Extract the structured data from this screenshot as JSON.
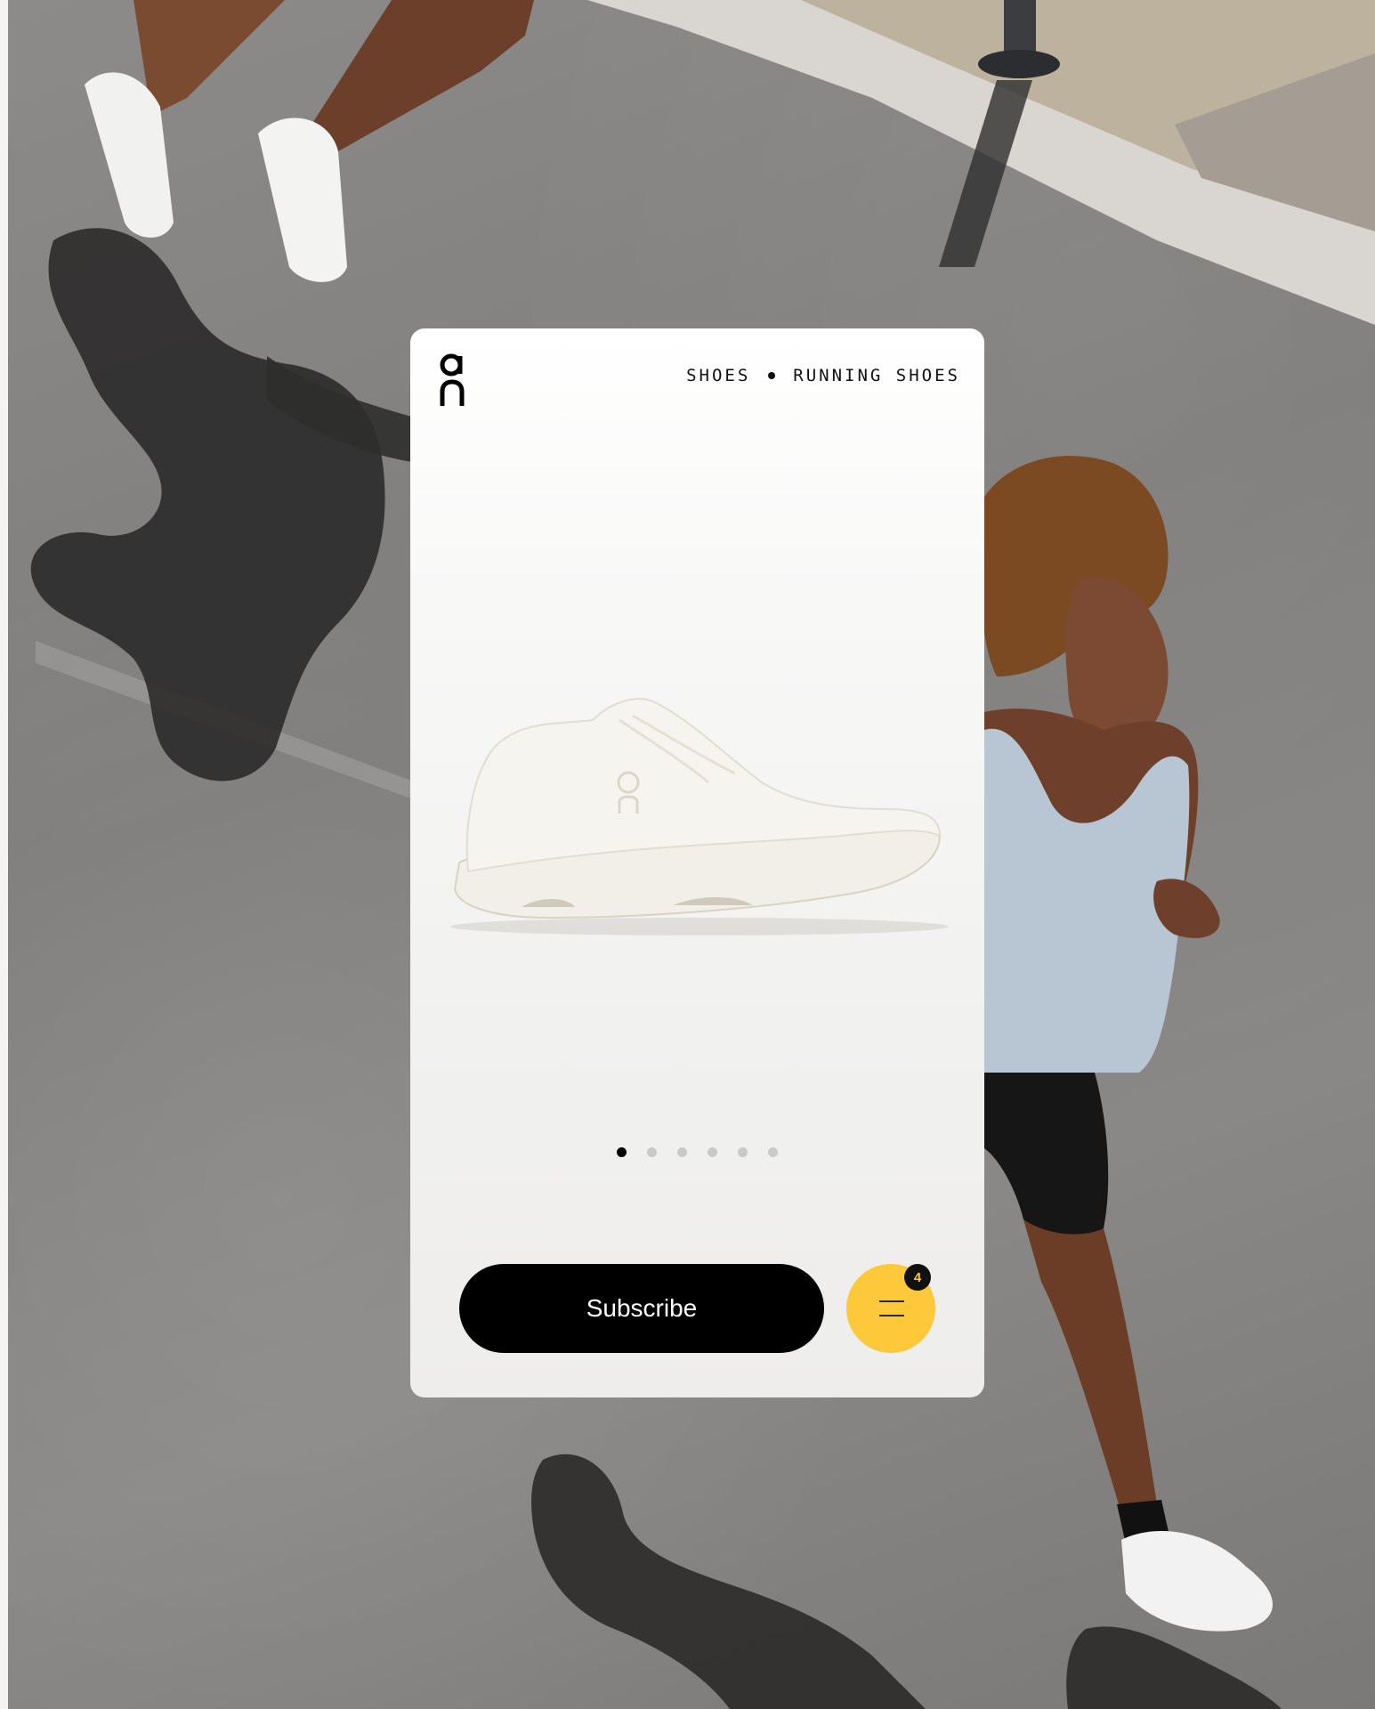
{
  "brand": {
    "name": "On",
    "logo_icon": "on-logo-icon"
  },
  "breadcrumb": {
    "items": [
      "SHOES",
      "RUNNING SHOES"
    ],
    "separator_icon": "dot-separator-icon"
  },
  "product": {
    "image_icon": "running-shoe-icon",
    "color": "#f0efea"
  },
  "carousel": {
    "slides_count": 6,
    "active_index": 0
  },
  "actions": {
    "subscribe_label": "Subscribe",
    "menu_icon": "menu-icon",
    "menu_badge_count": "4"
  },
  "colors": {
    "accent": "#fdc93b",
    "primary_button": "#000000",
    "card_background": "#ffffff"
  }
}
